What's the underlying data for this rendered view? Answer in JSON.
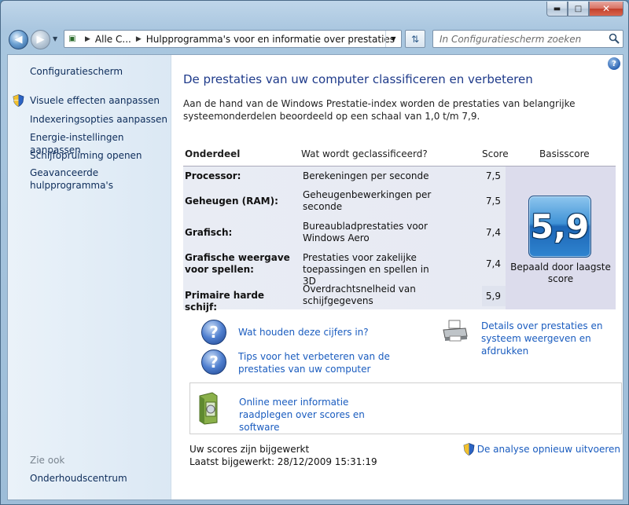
{
  "window": {
    "caption_minimize": "▬",
    "caption_maximize": "□",
    "caption_close": "✕"
  },
  "address_bar": {
    "crumb_root": "Alle C...",
    "crumb_current": "Hulpprogramma's voor en informatie over prestaties",
    "search_placeholder": "In Configuratiescherm zoeken"
  },
  "sidebar": {
    "home_link": "Configuratiescherm",
    "tasks": [
      {
        "label": "Visuele effecten aanpassen",
        "shield": true
      },
      {
        "label": "Indexeringsopties aanpassen",
        "shield": false
      },
      {
        "label": "Energie-instellingen aanpassen",
        "shield": false
      },
      {
        "label": "Schijfopruiming openen",
        "shield": false
      },
      {
        "label": "Geavanceerde hulpprogramma's",
        "shield": false
      }
    ],
    "see_also_heading": "Zie ook",
    "see_also": [
      {
        "label": "Onderhoudscentrum"
      }
    ]
  },
  "main": {
    "help_label": "?",
    "title": "De prestaties van uw computer classificeren en verbeteren",
    "description": "Aan de hand van de Windows Prestatie-index worden de prestaties van belangrijke systeemonderdelen beoordeeld op een schaal van 1,0 t/m 7,9.",
    "table": {
      "headers": {
        "component": "Onderdeel",
        "rated": "Wat wordt geclassificeerd?",
        "score": "Score",
        "base": "Basisscore"
      },
      "rows": [
        {
          "component": "Processor:",
          "rated": "Berekeningen per seconde",
          "score": "7,5"
        },
        {
          "component": "Geheugen (RAM):",
          "rated": "Geheugenbewerkingen per seconde",
          "score": "7,5"
        },
        {
          "component": "Grafisch:",
          "rated": "Bureaubladprestaties voor Windows Aero",
          "score": "7,4"
        },
        {
          "component": "Grafische weergave voor spellen:",
          "rated": "Prestaties voor zakelijke toepassingen en spellen in 3D",
          "score": "7,4"
        },
        {
          "component": "Primaire harde schijf:",
          "rated": "Overdrachtsnelheid van schijfgegevens",
          "score": "5,9"
        }
      ],
      "base_score": "5,9",
      "base_caption": "Bepaald door laagste score"
    },
    "links": {
      "what_mean": "Wat houden deze cijfers in?",
      "tips": "Tips voor het verbeteren van de prestaties van uw computer",
      "details": "Details over prestaties en systeem weergeven en afdrukken",
      "online": "Online meer informatie raadplegen over scores en software"
    },
    "status": {
      "line1": "Uw scores zijn bijgewerkt",
      "line2": "Laatst bijgewerkt: 28/12/2009 15:31:19",
      "rerun": "De analyse opnieuw uitvoeren"
    }
  },
  "colors": {
    "link": "#1a5cbf",
    "heading": "#1e3a8a",
    "badge": "#2f84cf"
  }
}
